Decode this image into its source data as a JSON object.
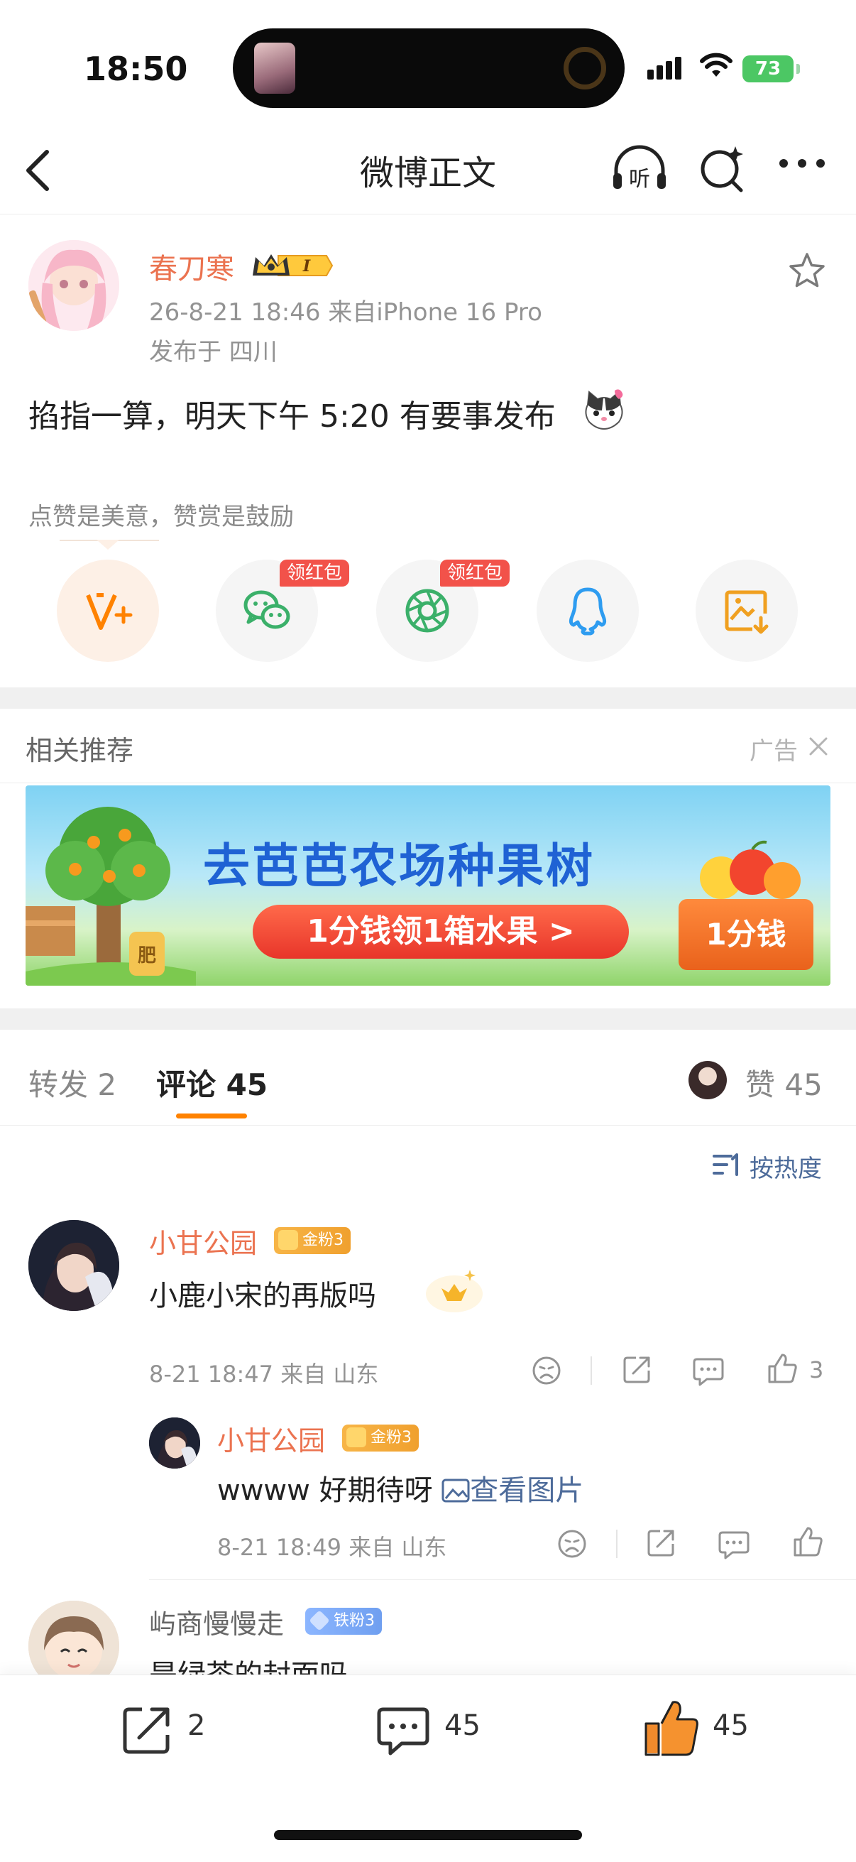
{
  "status_bar": {
    "time": "18:50",
    "battery": "73"
  },
  "nav": {
    "title": "微博正文"
  },
  "post": {
    "author": "春刀寒",
    "vip_level": "I",
    "time_source": "26-8-21 18:46  来自iPhone 16 Pro",
    "location": "发布于 四川",
    "text": "掐指一算，明天下午 5:20 有要事发布"
  },
  "reward": {
    "hint": "点赞是美意，赞赏是鼓励",
    "share_targets": [
      "v-plus",
      "wechat",
      "moments",
      "qq",
      "save-image"
    ],
    "redpack_label": "领红包"
  },
  "ad": {
    "section_title": "相关推荐",
    "label": "广告",
    "headline": "去芭芭农场种果树",
    "cta": "1分钱领1箱水果 >",
    "box_text": "1分钱",
    "barrel_text": "肥"
  },
  "tabs": {
    "forward": "转发 2",
    "comments": "评论 45",
    "likes": "赞 45"
  },
  "sort": {
    "label": "按热度"
  },
  "comments": [
    {
      "name": "小甘公园",
      "badge": "金粉3",
      "text": "小鹿小宋的再版吗",
      "meta": "8-21 18:47  来自 山东",
      "likes": "3",
      "reply": {
        "name": "小甘公园",
        "badge": "金粉3",
        "text": "wwww 好期待呀 ",
        "view_pic": "查看图片",
        "meta": "8-21 18:49  来自 山东"
      }
    },
    {
      "name": "屿商慢慢走",
      "badge": "铁粉3",
      "text": "是绿茶的封面吗"
    }
  ],
  "bottom_bar": {
    "reposts": "2",
    "comments": "45",
    "likes": "45"
  },
  "colors": {
    "accent": "#ff8200",
    "name": "#eb7350",
    "link": "#4d6b9a"
  }
}
